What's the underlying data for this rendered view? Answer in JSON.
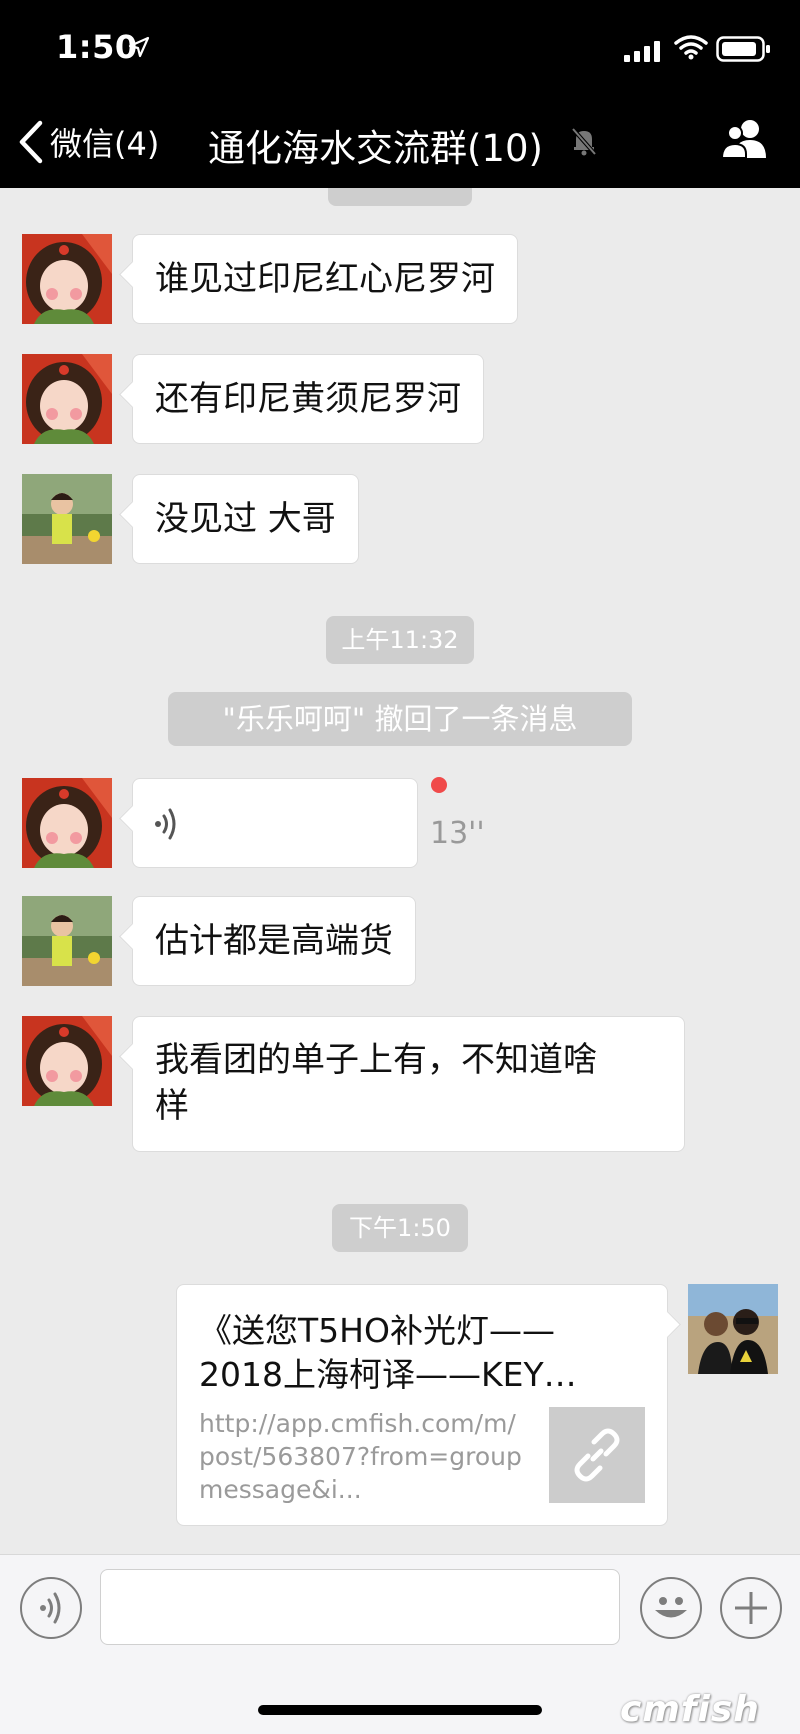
{
  "status_bar": {
    "time": "1:50"
  },
  "nav": {
    "back_label": "微信(4)",
    "title": "通化海水交流群(10)"
  },
  "messages": [
    {
      "text": "谁见过印尼红心尼罗河"
    },
    {
      "text": "还有印尼黄须尼罗河"
    },
    {
      "text": "没见过 大哥"
    },
    {
      "time": "上午11:32"
    },
    {
      "system": "\"乐乐呵呵\" 撤回了一条消息"
    },
    {
      "voice_duration": "13''"
    },
    {
      "text": "估计都是高端货"
    },
    {
      "text_line1": "我看团的单子上有，不知道啥",
      "text_line2": "样"
    },
    {
      "time": "下午1:50"
    },
    {
      "link_title": "《送您T5HO补光灯——2018上海柯译——KEY…",
      "link_url": "http://app.cmfish.com/m/post/563807?from=groupmessage&i..."
    }
  ],
  "watermark": "cmfish",
  "colors": {
    "bar_bg": "#000000",
    "chat_bg": "#ebebeb",
    "pill_bg": "#cecece",
    "unread_dot": "#f04a4a"
  },
  "icons": [
    "location-arrow-icon",
    "signal-icon",
    "wifi-icon",
    "battery-icon",
    "back-chevron-icon",
    "mute-bell-icon",
    "group-members-icon",
    "voice-wave-icon",
    "link-icon",
    "voice-input-icon",
    "emoji-icon",
    "plus-icon"
  ]
}
